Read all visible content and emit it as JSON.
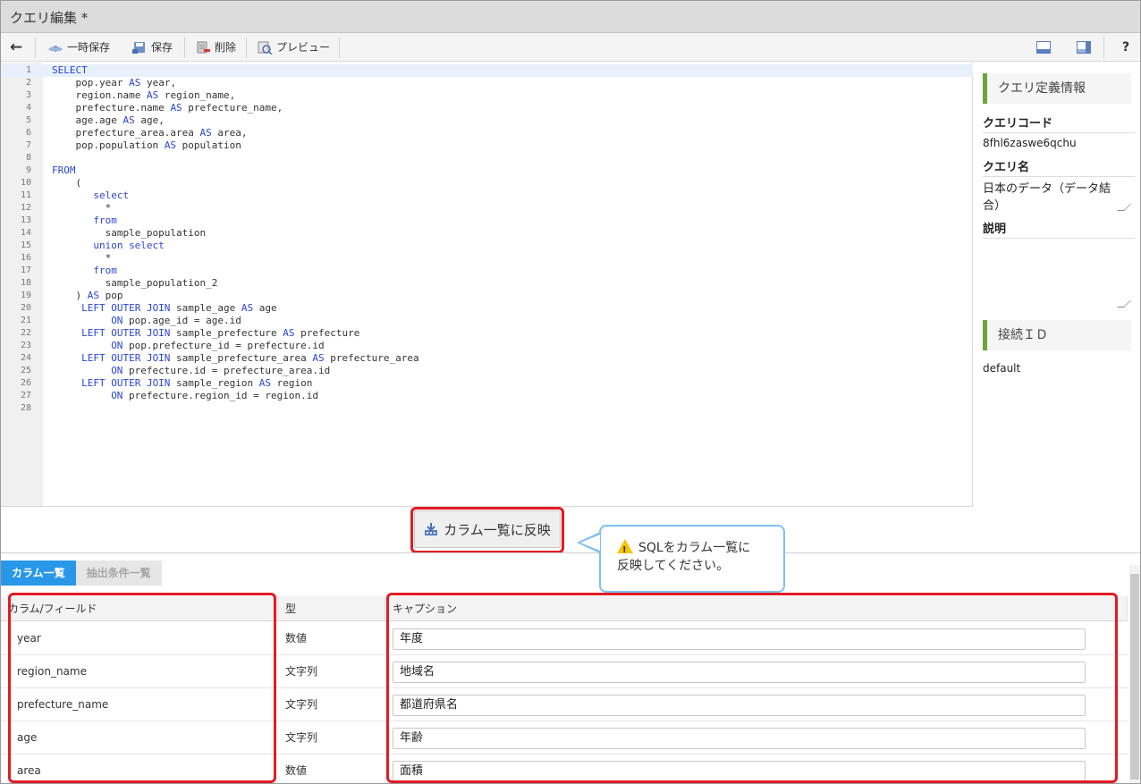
{
  "window": {
    "title": "クエリ編集 *"
  },
  "toolbar": {
    "back_label": "←",
    "temp_save_label": "一時保存",
    "save_label": "保存",
    "delete_label": "削除",
    "preview_label": "プレビュー",
    "help_label": "?"
  },
  "editor": {
    "lines": [
      {
        "n": "1",
        "indent": 0,
        "parts": [
          {
            "t": "SELECT",
            "kw": true
          }
        ]
      },
      {
        "n": "2",
        "indent": 4,
        "parts": [
          {
            "t": "pop.year "
          },
          {
            "t": "AS",
            "kw": true
          },
          {
            "t": " year,"
          }
        ]
      },
      {
        "n": "3",
        "indent": 4,
        "parts": [
          {
            "t": "region.name "
          },
          {
            "t": "AS",
            "kw": true
          },
          {
            "t": " region_name,"
          }
        ]
      },
      {
        "n": "4",
        "indent": 4,
        "parts": [
          {
            "t": "prefecture.name "
          },
          {
            "t": "AS",
            "kw": true
          },
          {
            "t": " prefecture_name,"
          }
        ]
      },
      {
        "n": "5",
        "indent": 4,
        "parts": [
          {
            "t": "age.age "
          },
          {
            "t": "AS",
            "kw": true
          },
          {
            "t": " age,"
          }
        ]
      },
      {
        "n": "6",
        "indent": 4,
        "parts": [
          {
            "t": "prefecture_area.area "
          },
          {
            "t": "AS",
            "kw": true
          },
          {
            "t": " area,"
          }
        ]
      },
      {
        "n": "7",
        "indent": 4,
        "parts": [
          {
            "t": "pop.population "
          },
          {
            "t": "AS",
            "kw": true
          },
          {
            "t": " population"
          }
        ]
      },
      {
        "n": "8",
        "indent": 0,
        "parts": []
      },
      {
        "n": "9",
        "indent": 0,
        "parts": [
          {
            "t": "FROM",
            "kw": true
          }
        ]
      },
      {
        "n": "10",
        "indent": 4,
        "parts": [
          {
            "t": "("
          }
        ]
      },
      {
        "n": "11",
        "indent": 7,
        "parts": [
          {
            "t": "select",
            "kw": true
          }
        ]
      },
      {
        "n": "12",
        "indent": 9,
        "parts": [
          {
            "t": "*"
          }
        ]
      },
      {
        "n": "13",
        "indent": 7,
        "parts": [
          {
            "t": "from",
            "kw": true
          }
        ]
      },
      {
        "n": "14",
        "indent": 9,
        "parts": [
          {
            "t": "sample_population"
          }
        ]
      },
      {
        "n": "15",
        "indent": 7,
        "parts": [
          {
            "t": "union select",
            "kw": true
          }
        ]
      },
      {
        "n": "16",
        "indent": 9,
        "parts": [
          {
            "t": "*"
          }
        ]
      },
      {
        "n": "17",
        "indent": 7,
        "parts": [
          {
            "t": "from",
            "kw": true
          }
        ]
      },
      {
        "n": "18",
        "indent": 9,
        "parts": [
          {
            "t": "sample_population_2"
          }
        ]
      },
      {
        "n": "19",
        "indent": 4,
        "parts": [
          {
            "t": ") "
          },
          {
            "t": "AS",
            "kw": true
          },
          {
            "t": " pop"
          }
        ]
      },
      {
        "n": "20",
        "indent": 5,
        "parts": [
          {
            "t": "LEFT OUTER JOIN",
            "kw": true
          },
          {
            "t": " sample_age "
          },
          {
            "t": "AS",
            "kw": true
          },
          {
            "t": " age"
          }
        ]
      },
      {
        "n": "21",
        "indent": 10,
        "parts": [
          {
            "t": "ON",
            "kw": true
          },
          {
            "t": " pop.age_id = age.id"
          }
        ]
      },
      {
        "n": "22",
        "indent": 5,
        "parts": [
          {
            "t": "LEFT OUTER JOIN",
            "kw": true
          },
          {
            "t": " sample_prefecture "
          },
          {
            "t": "AS",
            "kw": true
          },
          {
            "t": " prefecture"
          }
        ]
      },
      {
        "n": "23",
        "indent": 10,
        "parts": [
          {
            "t": "ON",
            "kw": true
          },
          {
            "t": " pop.prefecture_id = prefecture.id"
          }
        ]
      },
      {
        "n": "24",
        "indent": 5,
        "parts": [
          {
            "t": "LEFT OUTER JOIN",
            "kw": true
          },
          {
            "t": " sample_prefecture_area "
          },
          {
            "t": "AS",
            "kw": true
          },
          {
            "t": " prefecture_area"
          }
        ]
      },
      {
        "n": "25",
        "indent": 10,
        "parts": [
          {
            "t": "ON",
            "kw": true
          },
          {
            "t": " prefecture.id = prefecture_area.id"
          }
        ]
      },
      {
        "n": "26",
        "indent": 5,
        "parts": [
          {
            "t": "LEFT OUTER JOIN",
            "kw": true
          },
          {
            "t": " sample_region "
          },
          {
            "t": "AS",
            "kw": true
          },
          {
            "t": " region"
          }
        ]
      },
      {
        "n": "27",
        "indent": 10,
        "parts": [
          {
            "t": "ON",
            "kw": true
          },
          {
            "t": " prefecture.region_id = region.id"
          }
        ]
      },
      {
        "n": "28",
        "indent": 0,
        "parts": []
      }
    ]
  },
  "reflect_button": {
    "label": "カラム一覧に反映"
  },
  "tooltip": {
    "line1": "SQLをカラム一覧に",
    "line2": "反映してください。"
  },
  "side": {
    "section_query": "クエリ定義情報",
    "code_label": "クエリコード",
    "code_value": "8fhl6zaswe6qchu",
    "name_label": "クエリ名",
    "name_value_1": "日本のデータ（データ結",
    "name_value_2": "合）",
    "desc_label": "説明",
    "section_conn": "接続ＩＤ",
    "conn_value": "default"
  },
  "tabs": [
    {
      "label": "カラム一覧",
      "active": true
    },
    {
      "label": "抽出条件一覧",
      "active": false
    }
  ],
  "grid": {
    "headers": {
      "column": "カラム/フィールド",
      "type": "型",
      "caption": "キャプション"
    },
    "rows": [
      {
        "column": "year",
        "type": "数値",
        "caption": "年度"
      },
      {
        "column": "region_name",
        "type": "文字列",
        "caption": "地域名"
      },
      {
        "column": "prefecture_name",
        "type": "文字列",
        "caption": "都道府県名"
      },
      {
        "column": "age",
        "type": "文字列",
        "caption": "年齢"
      },
      {
        "column": "area",
        "type": "数値",
        "caption": "面積"
      }
    ]
  },
  "colors": {
    "keyword": "#2a46d8",
    "accent": "#2897e8",
    "highlight": "#e31b23",
    "section_bar": "#6fa33b"
  }
}
